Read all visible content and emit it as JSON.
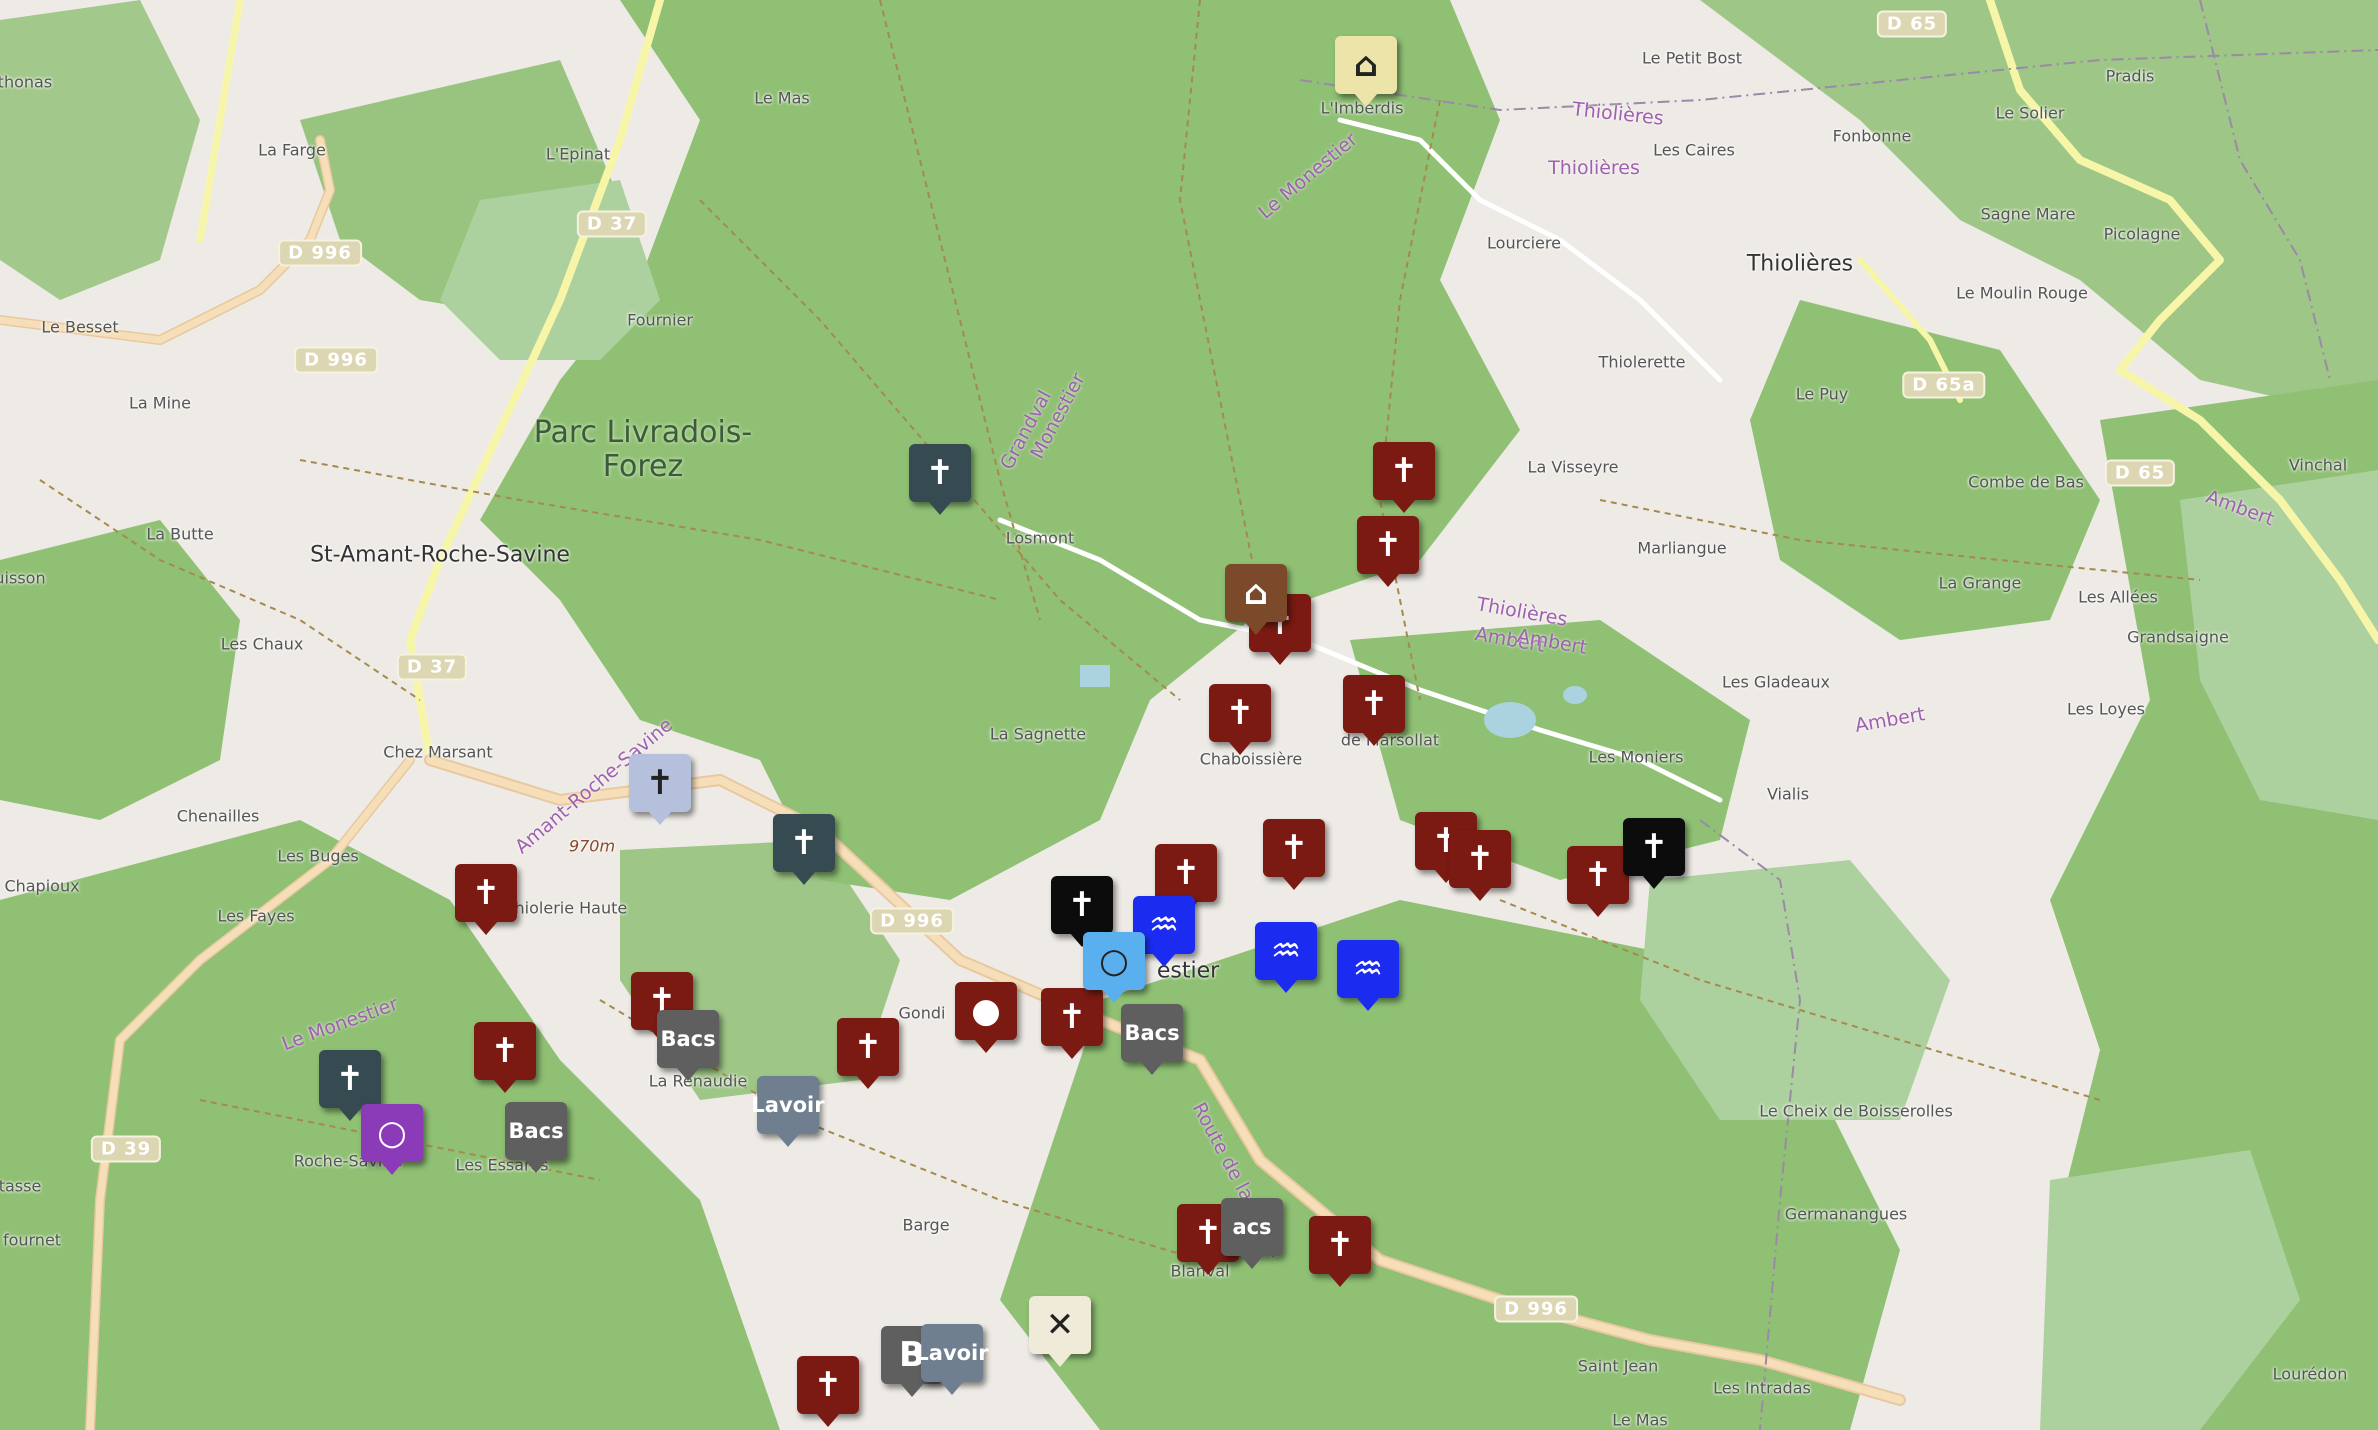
{
  "colors": {
    "cross_red": "#7a1a12",
    "dark_slate": "#364a52",
    "grey_bac": "#5f5f5f",
    "lavoir_blue": "#6f7f8f",
    "water_blue": "#1b2cf0",
    "light_blue": "#5ab0ee",
    "purple": "#8b3bb8",
    "black": "#0c0c0c",
    "pale_yellow": "#ece4a8",
    "pale_cream": "#f0ead8",
    "pale_lavender": "#b4c0dc",
    "brown": "#7a4a2a",
    "forest_dark": "#73ad5a",
    "forest_light": "#add19e",
    "road_yellow": "#f7f6a8"
  },
  "place_labels": [
    {
      "text": "éthonas",
      "kind": "small"
    },
    {
      "text": "La Farge",
      "kind": "small"
    },
    {
      "text": "Le Mas",
      "kind": "small"
    },
    {
      "text": "L'Epinat",
      "kind": "small"
    },
    {
      "text": "L'Imberdis",
      "kind": "small"
    },
    {
      "text": "Le Petit Bost",
      "kind": "small"
    },
    {
      "text": "Pradis",
      "kind": "small"
    },
    {
      "text": "Le Solier",
      "kind": "small"
    },
    {
      "text": "Les Caires",
      "kind": "small"
    },
    {
      "text": "Fonbonne",
      "kind": "small"
    },
    {
      "text": "Sagne Mare",
      "kind": "small"
    },
    {
      "text": "Picolagne",
      "kind": "small"
    },
    {
      "text": "Thiolières",
      "kind": "town"
    },
    {
      "text": "Lourciere",
      "kind": "small"
    },
    {
      "text": "Le Moulin Rouge",
      "kind": "small"
    },
    {
      "text": "Le Besset",
      "kind": "small"
    },
    {
      "text": "Fournier",
      "kind": "small"
    },
    {
      "text": "La Mine",
      "kind": "small"
    },
    {
      "text": "Thiolerette",
      "kind": "small"
    },
    {
      "text": "Le Puy",
      "kind": "small"
    },
    {
      "text": "Parc Livradois-Forez",
      "kind": "park"
    },
    {
      "text": "Combe de Bas",
      "kind": "small"
    },
    {
      "text": "Vinchal",
      "kind": "small"
    },
    {
      "text": "La Visseyre",
      "kind": "small"
    },
    {
      "text": "La Butte",
      "kind": "small"
    },
    {
      "text": "St-Amant-Roche-Savine",
      "kind": "town"
    },
    {
      "text": "Losmont",
      "kind": "small"
    },
    {
      "text": "Marliangue",
      "kind": "small"
    },
    {
      "text": "uisson",
      "kind": "small"
    },
    {
      "text": "La Grange",
      "kind": "small"
    },
    {
      "text": "Les Allées",
      "kind": "small"
    },
    {
      "text": "Les Chaux",
      "kind": "small"
    },
    {
      "text": "Grandsaigne",
      "kind": "small"
    },
    {
      "text": "Les Gladeaux",
      "kind": "small"
    },
    {
      "text": "Les Loyes",
      "kind": "small"
    },
    {
      "text": "La Sagnette",
      "kind": "small"
    },
    {
      "text": "Chaboissière",
      "kind": "small"
    },
    {
      "text": "Chez Marsant",
      "kind": "small"
    },
    {
      "text": "Les Moniers",
      "kind": "small"
    },
    {
      "text": "Vialis",
      "kind": "small"
    },
    {
      "text": "970m",
      "kind": "alt"
    },
    {
      "text": "Chenailles",
      "kind": "small"
    },
    {
      "text": "Les Buges",
      "kind": "small"
    },
    {
      "text": "Chapioux",
      "kind": "small"
    },
    {
      "text": "Thiolerie Haute",
      "kind": "small"
    },
    {
      "text": "Les Fayes",
      "kind": "small"
    },
    {
      "text": "estier",
      "kind": "town"
    },
    {
      "text": "La Renaudie",
      "kind": "small"
    },
    {
      "text": "Le Cheix de Boisserolles",
      "kind": "small"
    },
    {
      "text": "Roche-Savine",
      "kind": "small"
    },
    {
      "text": "Les Essares",
      "kind": "small"
    },
    {
      "text": "tasse",
      "kind": "small"
    },
    {
      "text": "Barge",
      "kind": "small"
    },
    {
      "text": "Germanangues",
      "kind": "small"
    },
    {
      "text": "fournet",
      "kind": "small"
    },
    {
      "text": "Blanval",
      "kind": "small"
    },
    {
      "text": "Saint Jean",
      "kind": "small"
    },
    {
      "text": "Les Intradas",
      "kind": "small"
    },
    {
      "text": "Lourédon",
      "kind": "small"
    },
    {
      "text": "Le Mas",
      "kind": "small"
    },
    {
      "text": "Gondi",
      "kind": "small"
    },
    {
      "text": "de Marsollat",
      "kind": "small"
    }
  ],
  "road_labels": [
    {
      "text": "Le Monestier"
    },
    {
      "text": "Thiolières"
    },
    {
      "text": "Thiolières"
    },
    {
      "text": "Ambert"
    },
    {
      "text": "Ambert"
    },
    {
      "text": "Thiolières"
    },
    {
      "text": "Ambert"
    },
    {
      "text": "Ambert"
    },
    {
      "text": "Grandval"
    },
    {
      "text": "Monestier"
    },
    {
      "text": "Amant-Roche-Savine"
    },
    {
      "text": "Le Monestier"
    },
    {
      "text": "Route de la Roche"
    }
  ],
  "shields": [
    "D 65",
    "D 37",
    "D 996",
    "D 996",
    "D 65a",
    "D 65",
    "D 37",
    "D 996",
    "D 39",
    "D 996"
  ],
  "markers": [
    {
      "type": "cross",
      "color": "#7a1a12",
      "icon": "✝"
    },
    {
      "type": "cross",
      "color": "#7a1a12",
      "icon": "✝"
    },
    {
      "type": "cross",
      "color": "#7a1a12",
      "icon": "✝"
    },
    {
      "type": "cross",
      "color": "#7a1a12",
      "icon": "✝"
    },
    {
      "type": "cross",
      "color": "#7a1a12",
      "icon": "✝"
    },
    {
      "type": "cross",
      "color": "#7a1a12",
      "icon": "✝"
    },
    {
      "type": "cross",
      "color": "#7a1a12",
      "icon": "✝"
    },
    {
      "type": "cross",
      "color": "#7a1a12",
      "icon": "✝"
    },
    {
      "type": "cross",
      "color": "#7a1a12",
      "icon": "✝"
    },
    {
      "type": "cross",
      "color": "#7a1a12",
      "icon": "✝"
    },
    {
      "type": "cross",
      "color": "#7a1a12",
      "icon": "✝"
    },
    {
      "type": "cross",
      "color": "#7a1a12",
      "icon": "✝"
    },
    {
      "type": "cross",
      "color": "#7a1a12",
      "icon": "✝"
    },
    {
      "type": "cross",
      "color": "#7a1a12",
      "icon": "✝"
    },
    {
      "type": "cross",
      "color": "#7a1a12",
      "icon": "✝"
    },
    {
      "type": "cross",
      "color": "#7a1a12",
      "icon": "✝"
    },
    {
      "type": "cross",
      "color": "#7a1a12",
      "icon": "✝"
    },
    {
      "type": "cross",
      "color": "#7a1a12",
      "icon": "✝"
    },
    {
      "type": "cross-slate",
      "color": "#364a52",
      "icon": "✝"
    },
    {
      "type": "cross-slate",
      "color": "#364a52",
      "icon": "✝"
    },
    {
      "type": "cross-slate",
      "color": "#364a52",
      "icon": "✝"
    },
    {
      "type": "cross-lavender",
      "color": "#b4c0dc",
      "icon": "✝",
      "dark": true
    },
    {
      "type": "cross-black",
      "color": "#0c0c0c",
      "icon": "✝"
    },
    {
      "type": "cross-black",
      "color": "#0c0c0c",
      "icon": "✝"
    },
    {
      "type": "bacs",
      "color": "#5f5f5f",
      "icon": "Bacs"
    },
    {
      "type": "bacs",
      "color": "#5f5f5f",
      "icon": "Bacs"
    },
    {
      "type": "bacs",
      "color": "#5f5f5f",
      "icon": "Bacs"
    },
    {
      "type": "bacs",
      "color": "#5f5f5f",
      "icon": "acs"
    },
    {
      "type": "bacs",
      "color": "#5f5f5f",
      "icon": "B"
    },
    {
      "type": "lavoir",
      "color": "#6f7f8f",
      "icon": "Lavoir"
    },
    {
      "type": "lavoir",
      "color": "#6f7f8f",
      "icon": "Lavoir"
    },
    {
      "type": "water",
      "color": "#1b2cf0",
      "icon": "♒"
    },
    {
      "type": "water",
      "color": "#1b2cf0",
      "icon": "♒"
    },
    {
      "type": "water",
      "color": "#1b2cf0",
      "icon": "♒"
    },
    {
      "type": "spring",
      "color": "#5ab0ee",
      "icon": "○",
      "dark": true
    },
    {
      "type": "purple",
      "color": "#8b3bb8",
      "icon": "○"
    },
    {
      "type": "dot",
      "color": "#7a1a12",
      "icon": "●"
    },
    {
      "type": "shelter",
      "color": "#ece4a8",
      "icon": "⌂",
      "dark": true
    },
    {
      "type": "mill",
      "color": "#f0ead8",
      "icon": "✕",
      "dark": true
    },
    {
      "type": "brown",
      "color": "#7a4a2a",
      "icon": "⌂"
    }
  ]
}
